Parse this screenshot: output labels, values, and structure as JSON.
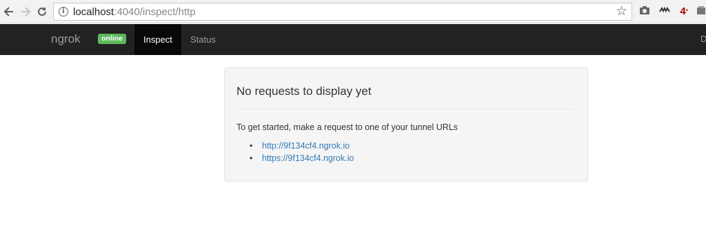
{
  "browser": {
    "url_host": "localhost",
    "url_rest": ":4040/inspect/http",
    "back_icon": "arrow-left-icon",
    "forward_icon": "arrow-right-icon",
    "reload_icon": "reload-icon",
    "extension_badge": "4"
  },
  "navbar": {
    "brand": "ngrok",
    "status_badge": "online",
    "tabs": [
      {
        "label": "Inspect",
        "active": true
      },
      {
        "label": "Status",
        "active": false
      }
    ]
  },
  "panel": {
    "title": "No requests to display yet",
    "intro": "To get started, make a request to one of your tunnel URLs",
    "urls": [
      "http://9f134cf4.ngrok.io",
      "https://9f134cf4.ngrok.io"
    ]
  },
  "colors": {
    "navbar_bg": "#222222",
    "badge_green": "#5cb85c",
    "link_blue": "#337ab7",
    "panel_bg": "#f5f5f5"
  }
}
